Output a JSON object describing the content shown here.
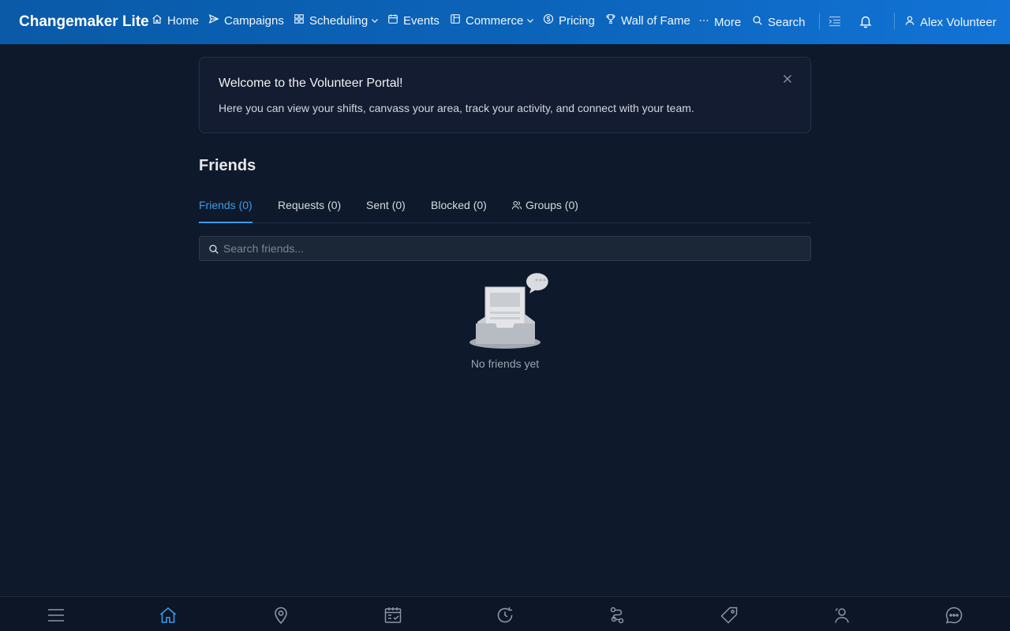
{
  "app": {
    "title": "Changemaker Lite"
  },
  "nav": {
    "home": "Home",
    "campaigns": "Campaigns",
    "scheduling": "Scheduling",
    "events": "Events",
    "commerce": "Commerce",
    "pricing": "Pricing",
    "wall_of_fame": "Wall of Fame",
    "more": "More",
    "search": "Search",
    "user": "Alex Volunteer"
  },
  "welcome": {
    "title": "Welcome to the Volunteer Portal!",
    "text": "Here you can view your shifts, canvass your area, track your activity, and connect with your team."
  },
  "page": {
    "title": "Friends"
  },
  "tabs": [
    {
      "label": "Friends (0)",
      "active": true
    },
    {
      "label": "Requests (0)",
      "active": false
    },
    {
      "label": "Sent (0)",
      "active": false
    },
    {
      "label": "Blocked (0)",
      "active": false
    },
    {
      "label": "Groups (0)",
      "active": false
    }
  ],
  "search": {
    "placeholder": "Search friends...",
    "value": ""
  },
  "empty": {
    "text": "No friends yet"
  },
  "bottom_nav": [
    {
      "icon": "menu-icon"
    },
    {
      "icon": "home-icon",
      "active": true
    },
    {
      "icon": "map-pin-icon"
    },
    {
      "icon": "calendar-check-icon"
    },
    {
      "icon": "history-icon"
    },
    {
      "icon": "route-icon"
    },
    {
      "icon": "tag-icon"
    },
    {
      "icon": "users-icon"
    },
    {
      "icon": "chat-icon"
    }
  ],
  "colors": {
    "topbar": "#0b63b8",
    "background": "#0e1a2b",
    "accent": "#3e9ae8"
  }
}
